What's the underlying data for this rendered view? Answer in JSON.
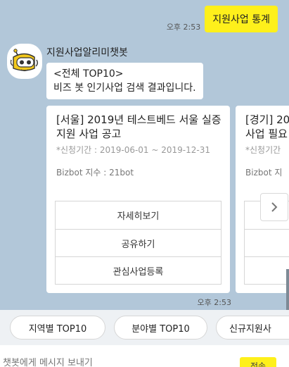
{
  "outgoing": {
    "time": "오후 2:53",
    "text": "지원사업 통계"
  },
  "bot": {
    "name": "지원사업알리미챗봇",
    "message_line1": "<전체 TOP10>",
    "message_line2": "비즈 봇 인기사업 검색 결과입니다.",
    "time": "오후 2:53"
  },
  "cards": [
    {
      "title": "[서울] 2019년 테스트베드 서울 실증지원 사업 공고",
      "period": "*신청기간 : 2019-06-01 ~ 2019-12-31",
      "index": "Bizbot 지수 : 21bot",
      "buttons": [
        "자세히보기",
        "공유하기",
        "관심사업등록"
      ]
    },
    {
      "title": "[경기] 20",
      "title2": "사업 필요",
      "period": "*신청기간",
      "index": "Bizbot 지",
      "buttons": [
        "",
        "",
        ""
      ]
    }
  ],
  "quick_replies": [
    "지역별 TOP10",
    "분야별 TOP10",
    "신규지원사"
  ],
  "input": {
    "placeholder": "챗봇에게 메시지 보내기",
    "send_label": "전송"
  },
  "colors": {
    "chat_bg": "#b2c7d9",
    "accent": "#fef01b"
  }
}
